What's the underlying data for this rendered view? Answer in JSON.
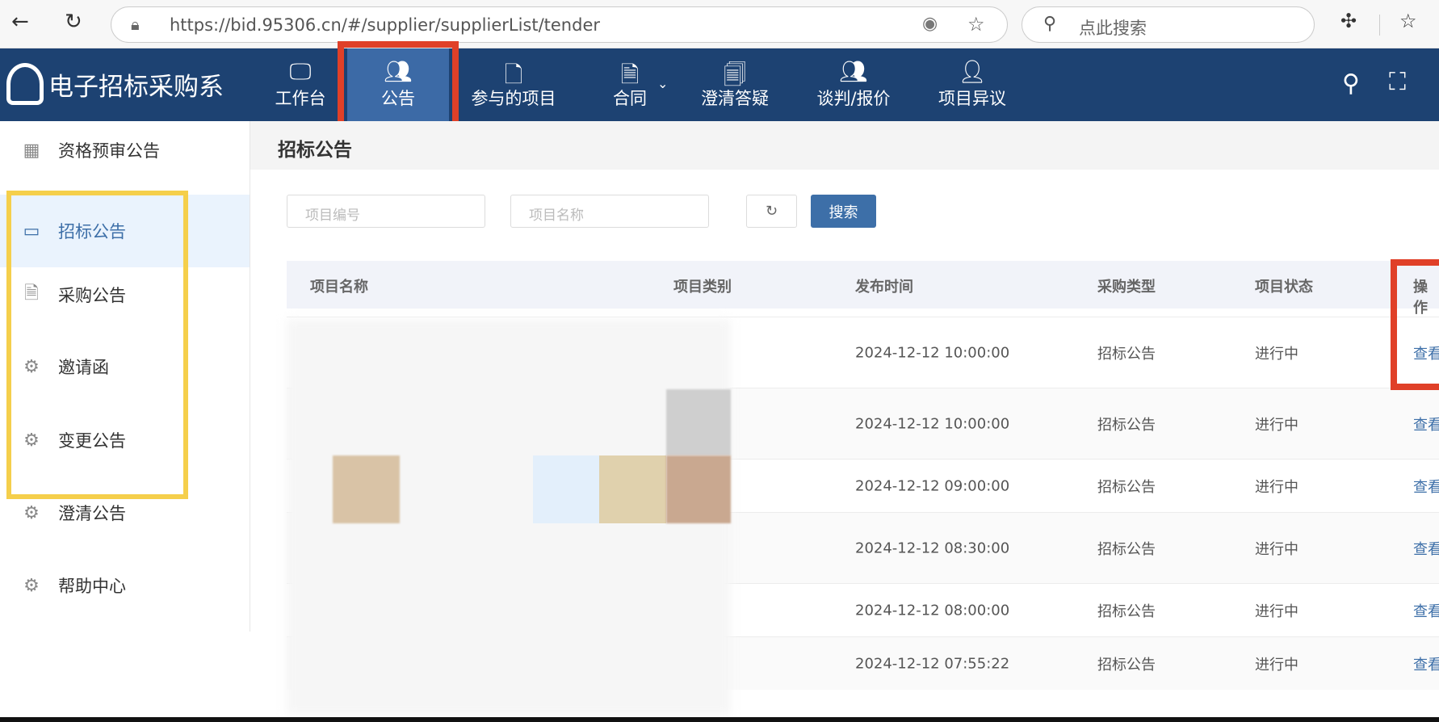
{
  "browser": {
    "url": "https://bid.95306.cn/#/supplier/supplierList/tender",
    "search_placeholder": "点此搜索"
  },
  "nav": {
    "logo_text": "电子招标采购系",
    "items": [
      {
        "label": "工作台",
        "icon": "monitor-icon"
      },
      {
        "label": "公告",
        "icon": "users-icon",
        "active": true
      },
      {
        "label": "参与的项目",
        "icon": "document-icon"
      },
      {
        "label": "合同",
        "icon": "contract-icon"
      },
      {
        "label": "澄清答疑",
        "icon": "qa-icon"
      },
      {
        "label": "谈判/报价",
        "icon": "users-icon"
      },
      {
        "label": "项目异议",
        "icon": "objection-icon"
      }
    ]
  },
  "sidebar": {
    "items": [
      {
        "label": "资格预审公告",
        "icon": "grid-icon"
      },
      {
        "label": "招标公告",
        "icon": "monitor-icon",
        "active": true
      },
      {
        "label": "采购公告",
        "icon": "document-icon"
      },
      {
        "label": "邀请函",
        "icon": "gear-icon"
      },
      {
        "label": "变更公告",
        "icon": "gear-icon"
      },
      {
        "label": "澄清公告",
        "icon": "gear-icon"
      },
      {
        "label": "帮助中心",
        "icon": "gear-icon"
      }
    ]
  },
  "page": {
    "title": "招标公告"
  },
  "filters": {
    "code_placeholder": "项目编号",
    "name_placeholder": "项目名称",
    "search_label": "搜索"
  },
  "table": {
    "headers": [
      "项目名称",
      "项目类别",
      "发布时间",
      "采购类型",
      "项目状态",
      "操作"
    ],
    "rows": [
      {
        "time": "2024-12-12 10:00:00",
        "type": "招标公告",
        "status": "进行中",
        "action": "查看"
      },
      {
        "time": "2024-12-12 10:00:00",
        "type": "招标公告",
        "status": "进行中",
        "action": "查看"
      },
      {
        "time": "2024-12-12 09:00:00",
        "type": "招标公告",
        "status": "进行中",
        "action": "查看"
      },
      {
        "time": "2024-12-12 08:30:00",
        "type": "招标公告",
        "status": "进行中",
        "action": "查看"
      },
      {
        "time": "2024-12-12 08:00:00",
        "type": "招标公告",
        "status": "进行中",
        "action": "查看"
      },
      {
        "time": "2024-12-12 07:55:22",
        "type": "招标公告",
        "status": "进行中",
        "action": "查看"
      }
    ]
  },
  "colors": {
    "nav_bg": "#1d4272",
    "active_nav": "#3c6aa6",
    "accent": "#3d6fa8",
    "highlight_red": "#e04028",
    "highlight_yellow": "#f5cf4b"
  }
}
